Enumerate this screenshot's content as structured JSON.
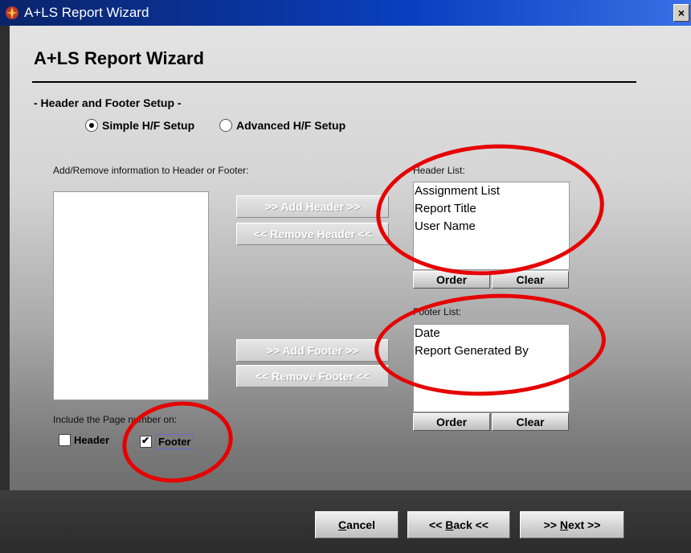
{
  "window": {
    "title": "A+LS Report Wizard",
    "close_label": "×"
  },
  "wizard": {
    "title": "A+LS Report Wizard",
    "section": "- Header and Footer Setup -",
    "radio_simple": "Simple H/F Setup",
    "radio_advanced": "Advanced H/F Setup",
    "selected_mode": "simple"
  },
  "available": {
    "label": "Add/Remove information to Header or Footer:",
    "items": []
  },
  "buttons": {
    "add_header": ">> Add Header >>",
    "remove_header": "<< Remove Header <<",
    "add_footer": ">> Add Footer >>",
    "remove_footer": "<< Remove Footer <<"
  },
  "header_list": {
    "label": "Header List:",
    "items": [
      "Assignment List",
      "Report Title",
      "User Name"
    ],
    "order": "Order",
    "clear": "Clear"
  },
  "footer_list": {
    "label": "Footer List:",
    "items": [
      "Date",
      "Report Generated By"
    ],
    "order": "Order",
    "clear": "Clear"
  },
  "page_number": {
    "label": "Include the Page number on:",
    "header": "Header",
    "header_checked": false,
    "footer": "Footer",
    "footer_checked": true
  },
  "nav": {
    "cancel_key": "C",
    "cancel_rest": "ancel",
    "back_pre": "<< ",
    "back_key": "B",
    "back_rest": "ack <<",
    "next_pre": ">> ",
    "next_key": "N",
    "next_rest": "ext >>"
  },
  "colors": {
    "annotation": "#e60000",
    "titlebar": "#0a246a"
  }
}
